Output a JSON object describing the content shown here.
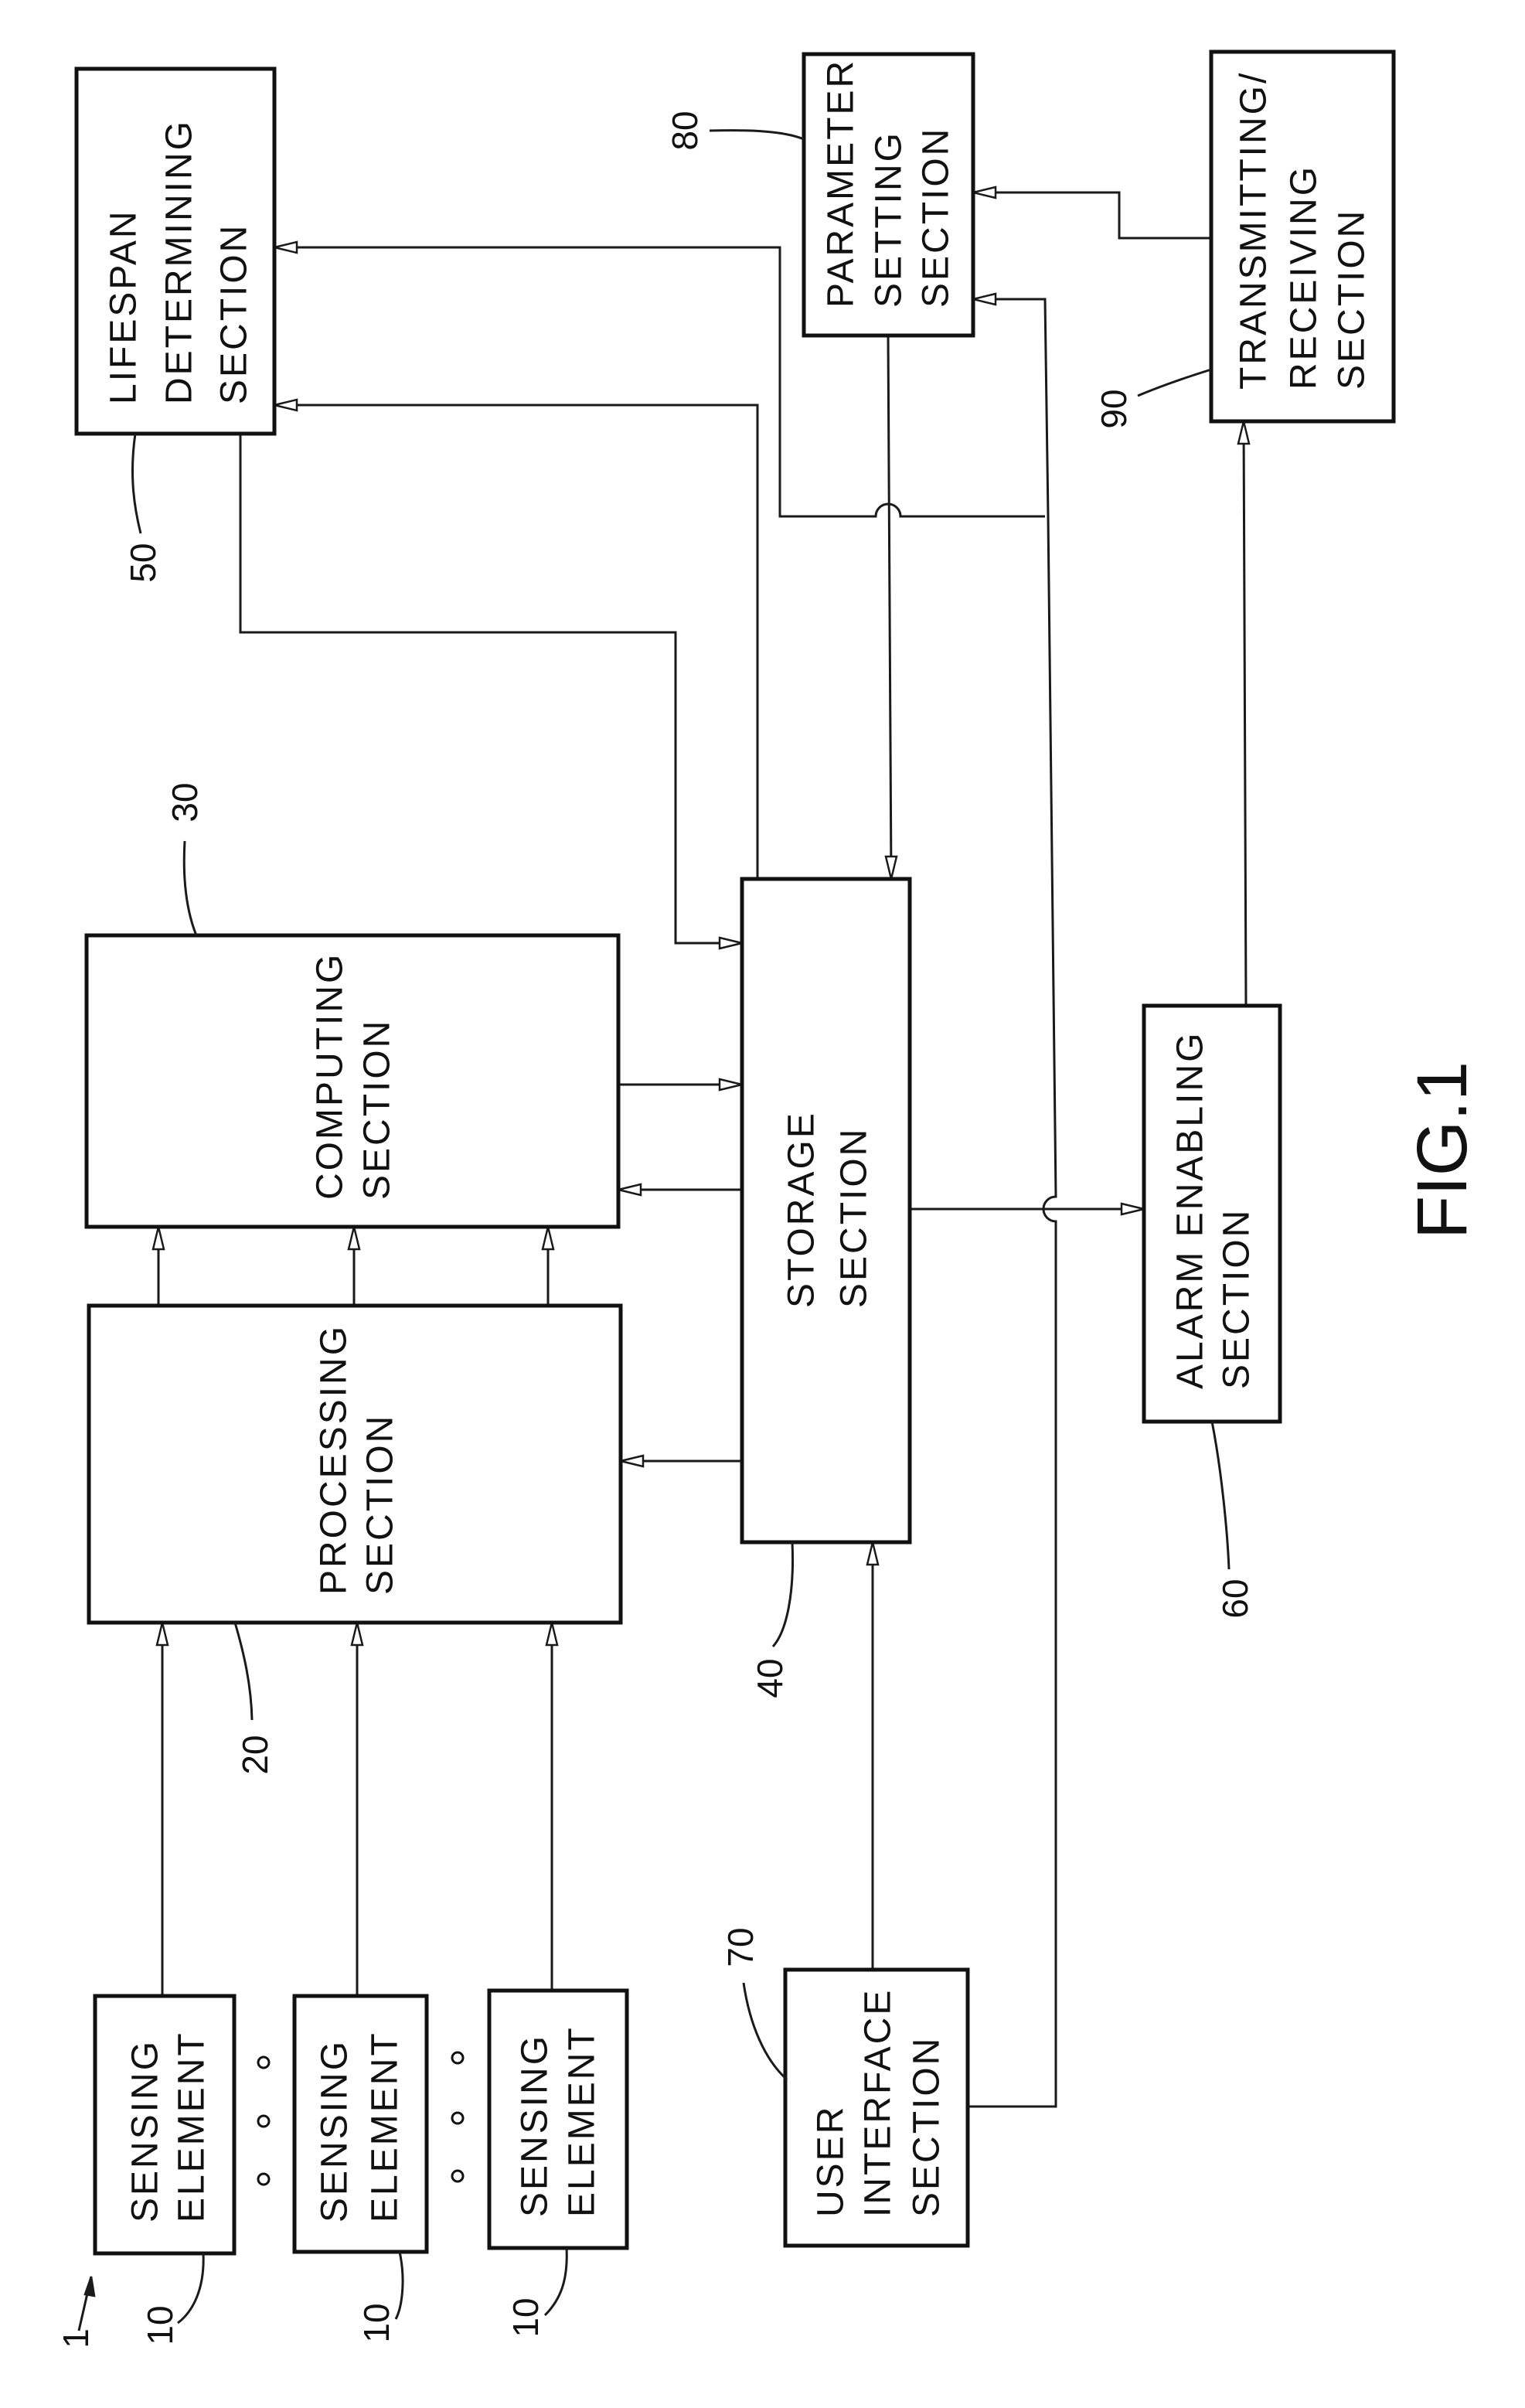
{
  "figure": {
    "label": "FIG.1",
    "system_ref": "1",
    "orientation": "rotated 90° counter-clockwise"
  },
  "blocks": {
    "lifespan": {
      "ref": "50",
      "lines": [
        "LIFESPAN",
        "DETERMINING",
        "SECTION"
      ]
    },
    "parameter": {
      "ref": "80",
      "lines": [
        "PARAMETER",
        "SETTING",
        "SECTION"
      ]
    },
    "transmitting": {
      "ref": "90",
      "lines": [
        "TRANSMITTING/",
        "RECEIVING",
        "SECTION"
      ]
    },
    "computing": {
      "ref": "30",
      "lines": [
        "COMPUTING",
        "SECTION"
      ]
    },
    "processing": {
      "ref": "20",
      "lines": [
        "PROCESSING",
        "SECTION"
      ]
    },
    "storage": {
      "ref": "40",
      "lines": [
        "STORAGE",
        "SECTION"
      ]
    },
    "alarm": {
      "ref": "60",
      "lines": [
        "ALARM ENABLING",
        "SECTION"
      ]
    },
    "user_interface": {
      "ref": "70",
      "lines": [
        "USER",
        "INTERFACE",
        "SECTION"
      ]
    },
    "sensing_1": {
      "ref": "10",
      "lines": [
        "SENSING",
        "ELEMENT"
      ]
    },
    "sensing_2": {
      "ref": "10",
      "lines": [
        "SENSING",
        "ELEMENT"
      ]
    },
    "sensing_3": {
      "ref": "10",
      "lines": [
        "SENSING",
        "ELEMENT"
      ]
    }
  },
  "ellipsis_marks": [
    "o o o",
    "o o o"
  ],
  "connections": [
    {
      "from": "sensing_1",
      "to": "processing"
    },
    {
      "from": "sensing_2",
      "to": "processing"
    },
    {
      "from": "sensing_3",
      "to": "processing"
    },
    {
      "from": "processing",
      "to": "computing",
      "count": 3
    },
    {
      "from": "computing",
      "to": "storage"
    },
    {
      "from": "storage",
      "to": "computing"
    },
    {
      "from": "storage",
      "to": "processing"
    },
    {
      "from": "lifespan",
      "to": "storage"
    },
    {
      "from": "storage",
      "to": "lifespan"
    },
    {
      "from": "user_interface",
      "to": "lifespan"
    },
    {
      "from": "user_interface",
      "to": "parameter"
    },
    {
      "from": "user_interface",
      "to": "storage"
    },
    {
      "from": "parameter",
      "to": "storage"
    },
    {
      "from": "transmitting",
      "to": "parameter"
    },
    {
      "from": "storage",
      "to": "alarm"
    },
    {
      "from": "alarm",
      "to": "transmitting"
    }
  ]
}
